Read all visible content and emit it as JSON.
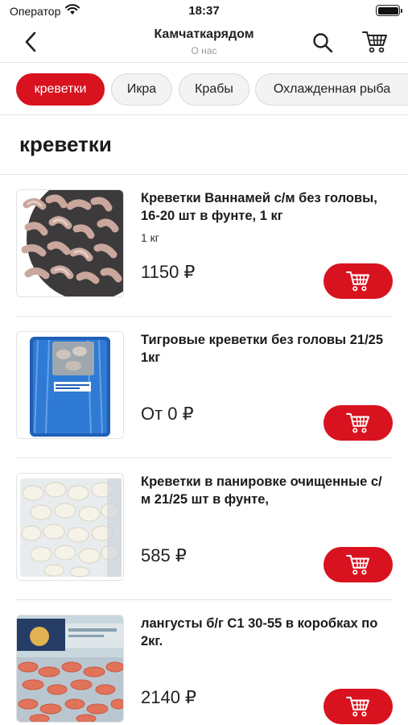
{
  "status_bar": {
    "carrier": "Оператор",
    "time": "18:37"
  },
  "nav": {
    "title": "Камчаткарядом",
    "subtitle": "О нас"
  },
  "categories": [
    {
      "label": "креветки",
      "active": true
    },
    {
      "label": "Икра",
      "active": false
    },
    {
      "label": "Крабы",
      "active": false
    },
    {
      "label": "Охлажденная рыба",
      "active": false
    }
  ],
  "section": {
    "title": "креветки"
  },
  "products": [
    {
      "name": "Креветки Ваннамей с/м без головы, 16-20 шт в фунте, 1 кг",
      "weight": "1 кг",
      "price": "1150 ₽"
    },
    {
      "name": "Тигровые креветки без головы 21/25 1кг",
      "weight": "",
      "price": "От 0 ₽"
    },
    {
      "name": "Креветки в панировке очищенные с/м 21/25 шт в фунте,",
      "weight": "",
      "price": "585 ₽"
    },
    {
      "name": "лангусты б/г С1 30-55  в коробках по 2кг.",
      "weight": "",
      "price": "2140 ₽"
    }
  ],
  "colors": {
    "accent": "#d9121f"
  },
  "icons": [
    "wifi-icon",
    "battery-icon",
    "back-chevron-icon",
    "search-icon",
    "cart-icon"
  ]
}
